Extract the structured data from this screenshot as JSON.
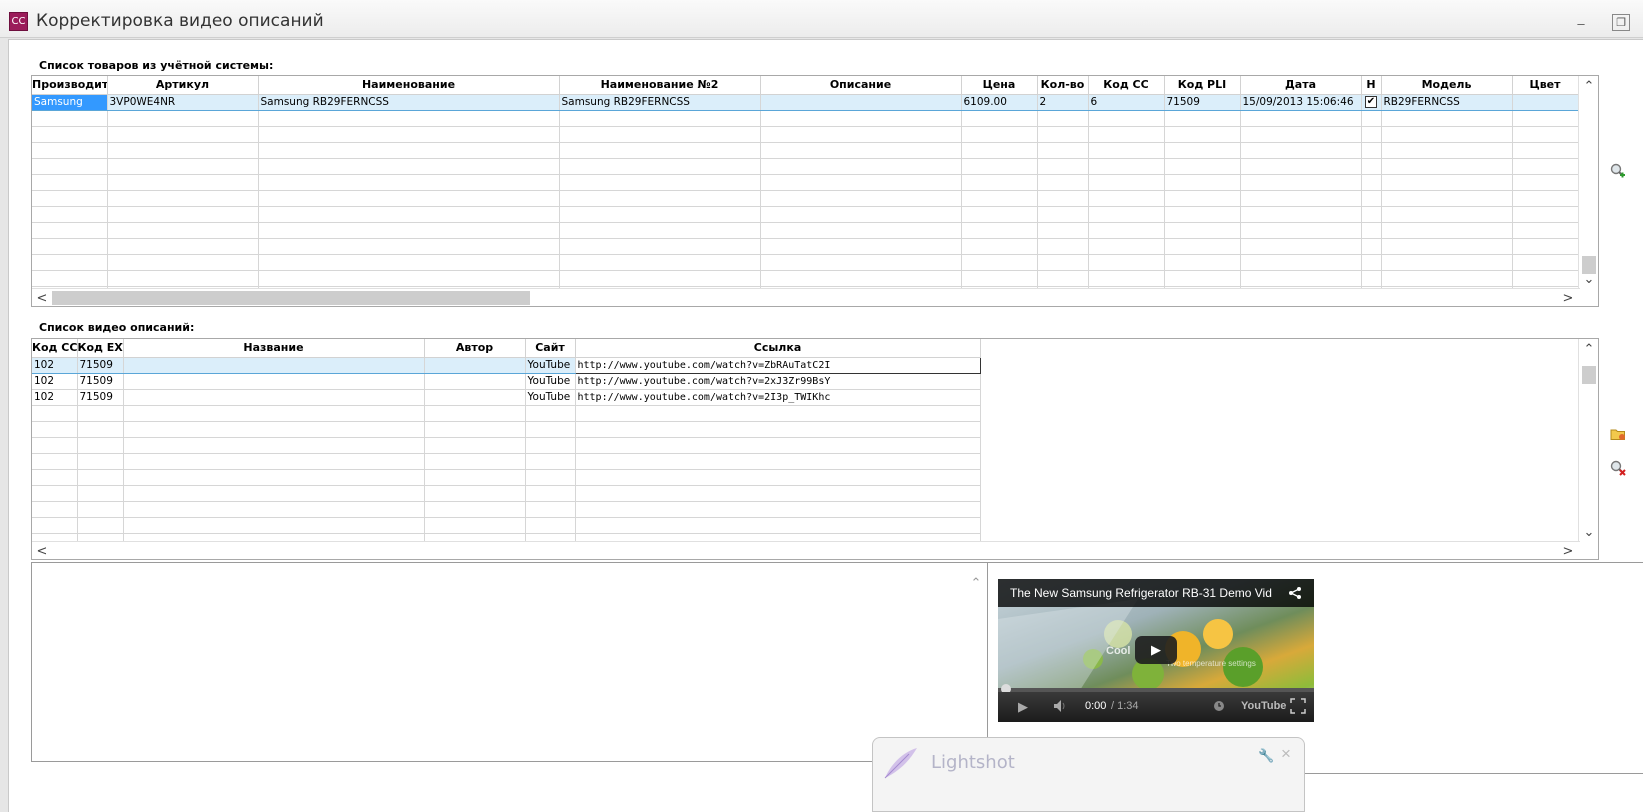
{
  "window": {
    "title": "Корректировка видео описаний",
    "app_icon_text": "CC",
    "minimize_glyph": "‒",
    "restore_glyph": "❐"
  },
  "products": {
    "label": "Список товаров из учётной системы:",
    "columns": [
      "Производите",
      "Артикул",
      "Наименование",
      "Наименование №2",
      "Описание",
      "Цена",
      "Кол-во",
      "Код CC",
      "Код PLI",
      "Дата",
      "Н",
      "Модель",
      "Цвет"
    ],
    "rows": [
      [
        "Samsung",
        "3VP0WE4NR",
        "Samsung RB29FERNCSS",
        "Samsung RB29FERNCSS",
        "",
        "6109.00",
        "2",
        "6",
        "71509",
        "15/09/2013 15:06:46",
        "✔",
        "RB29FERNCSS",
        ""
      ]
    ]
  },
  "videos": {
    "label": "Список видео описаний:",
    "columns": [
      "Код CC",
      "Код EXT",
      "Название",
      "Автор",
      "Сайт",
      "Ссылка"
    ],
    "rows": [
      [
        "102",
        "71509",
        "",
        "",
        "YouTube",
        "http://www.youtube.com/watch?v=ZbRAuTatC2I"
      ],
      [
        "102",
        "71509",
        "",
        "",
        "YouTube",
        "http://www.youtube.com/watch?v=2xJ3Zr99BsY"
      ],
      [
        "102",
        "71509",
        "",
        "",
        "YouTube",
        "http://www.youtube.com/watch?v=2I3p_TWIKhc"
      ]
    ]
  },
  "scroll": {
    "up": "⌃",
    "down": "⌄",
    "left": "<",
    "right": ">"
  },
  "player": {
    "title": "The New Samsung Refrigerator RB-31 Demo Vid",
    "time_current": "0:00",
    "time_total": "/ 1:34",
    "youtube_label": "YouTube",
    "overlay_1": "Cool",
    "overlay_2": "Two temperature settings",
    "progress": 0
  },
  "lightshot": {
    "label": "Lightshot",
    "close_glyph": "×"
  },
  "colors": {
    "selection": "#3399ff",
    "row_highlight": "#dbeefa",
    "accent": "#9b1c5a"
  }
}
